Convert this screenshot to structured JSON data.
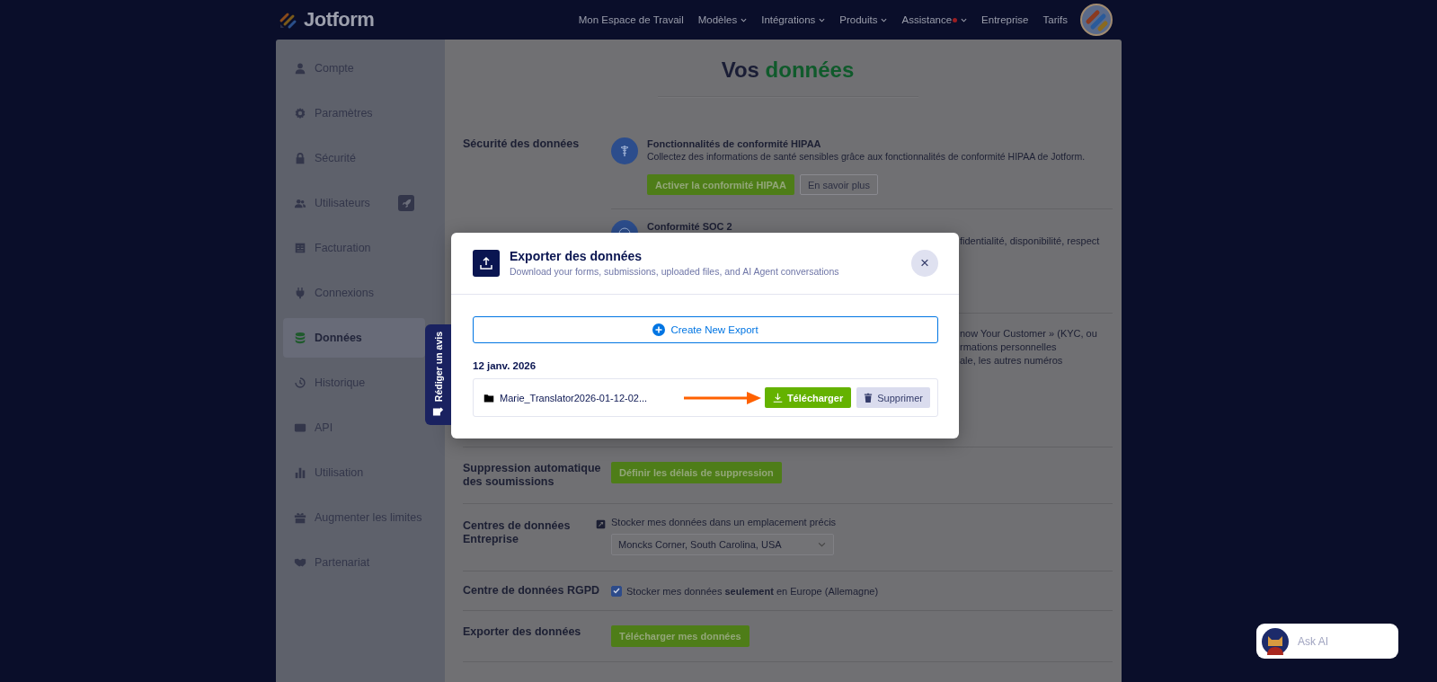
{
  "nav": {
    "brand": "Jotform",
    "items": [
      {
        "label": "Mon Espace de Travail",
        "dropdown": false,
        "dot": false
      },
      {
        "label": "Modèles",
        "dropdown": true,
        "dot": false
      },
      {
        "label": "Intégrations",
        "dropdown": true,
        "dot": false
      },
      {
        "label": "Produits",
        "dropdown": true,
        "dot": false
      },
      {
        "label": "Assistance",
        "dropdown": true,
        "dot": true
      },
      {
        "label": "Entreprise",
        "dropdown": false,
        "dot": false
      },
      {
        "label": "Tarifs",
        "dropdown": false,
        "dot": false
      }
    ]
  },
  "sidebar": {
    "items": [
      {
        "label": "Compte",
        "selected": false
      },
      {
        "label": "Paramètres",
        "selected": false
      },
      {
        "label": "Sécurité",
        "selected": false
      },
      {
        "label": "Utilisateurs",
        "selected": false,
        "badge": true
      },
      {
        "label": "Facturation",
        "selected": false
      },
      {
        "label": "Connexions",
        "selected": false
      },
      {
        "label": "Données",
        "selected": true
      },
      {
        "label": "Historique",
        "selected": false
      },
      {
        "label": "API",
        "selected": false
      },
      {
        "label": "Utilisation",
        "selected": false
      },
      {
        "label": "Augmenter les limites",
        "selected": false
      },
      {
        "label": "Partenariat",
        "selected": false
      }
    ]
  },
  "page": {
    "title": "Vos",
    "title_highlight": "données"
  },
  "sections": [
    {
      "kind": "compliance",
      "label": "Sécurité des données",
      "items": [
        {
          "title": "Fonctionnalités de conformité HIPAA",
          "description": "Collectez des informations de santé sensibles grâce aux fonctionnalités de conformité HIPAA de Jotform.",
          "buttons": [
            {
              "label": "Activer la conformité HIPAA",
              "kind": "primary"
            },
            {
              "label": "En savoir plus",
              "kind": "secondary"
            }
          ]
        },
        {
          "title": "Conformité SOC 2",
          "description": "fidentialité, disponibilité, respect"
        }
      ]
    },
    {
      "kind": "text",
      "lines": [
        "now Your Customer » (KYC, ou",
        "rmations personnelles",
        "ale, les autres numéros"
      ]
    },
    {
      "kind": "button",
      "label": "Suppression automatique des soumissions",
      "button": "Définir les délais de suppression"
    },
    {
      "kind": "select",
      "label": "Centres de données Entreprise",
      "hint": "Stocker mes données dans un emplacement précis",
      "value": "Moncks Corner, South Carolina, USA"
    },
    {
      "kind": "checkbox",
      "label": "Centre de données RGPD",
      "checked": true,
      "text": "Stocker mes données **seulement** en Europe (Allemagne)"
    },
    {
      "kind": "button",
      "label": "Exporter des données",
      "button": "Télécharger mes données"
    }
  ],
  "modal": {
    "title": "Exporter des données",
    "subtitle": "Download your forms, submissions, uploaded files, and AI Agent conversations",
    "close": "×",
    "create": "Create New Export",
    "date": "12 janv. 2026",
    "files": [
      {
        "name": "Marie_Translator2026-01-12-02...",
        "download": "Télécharger",
        "delete": "Supprimer"
      }
    ]
  },
  "feedback_tab": {
    "label": "Rédiger un avis"
  },
  "ask_ai": {
    "placeholder": "Ask AI"
  }
}
